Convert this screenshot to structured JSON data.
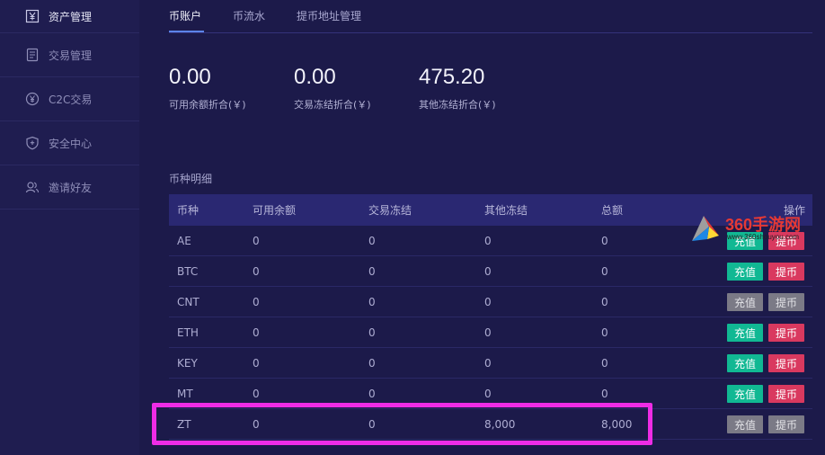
{
  "sidebar": {
    "items": [
      {
        "label": "资产管理",
        "icon": "yen-box-icon"
      },
      {
        "label": "交易管理",
        "icon": "document-icon"
      },
      {
        "label": "C2C交易",
        "icon": "yen-circle-icon"
      },
      {
        "label": "安全中心",
        "icon": "shield-icon"
      },
      {
        "label": "邀请好友",
        "icon": "users-icon"
      }
    ]
  },
  "tabs": [
    "币账户",
    "币流水",
    "提币地址管理"
  ],
  "stats": [
    {
      "value": "0.00",
      "label": "可用余额折合(￥)"
    },
    {
      "value": "0.00",
      "label": "交易冻结折合(￥)"
    },
    {
      "value": "475.20",
      "label": "其他冻结折合(￥)"
    }
  ],
  "section_title": "币种明细",
  "table": {
    "headers": [
      "币种",
      "可用余额",
      "交易冻结",
      "其他冻结",
      "总额",
      "操作"
    ],
    "rows": [
      {
        "coin": "AE",
        "available": "0",
        "trade_frozen": "0",
        "other_frozen": "0",
        "total": "0",
        "enabled": true
      },
      {
        "coin": "BTC",
        "available": "0",
        "trade_frozen": "0",
        "other_frozen": "0",
        "total": "0",
        "enabled": true
      },
      {
        "coin": "CNT",
        "available": "0",
        "trade_frozen": "0",
        "other_frozen": "0",
        "total": "0",
        "enabled": false
      },
      {
        "coin": "ETH",
        "available": "0",
        "trade_frozen": "0",
        "other_frozen": "0",
        "total": "0",
        "enabled": true
      },
      {
        "coin": "KEY",
        "available": "0",
        "trade_frozen": "0",
        "other_frozen": "0",
        "total": "0",
        "enabled": true
      },
      {
        "coin": "MT",
        "available": "0",
        "trade_frozen": "0",
        "other_frozen": "0",
        "total": "0",
        "enabled": true
      },
      {
        "coin": "ZT",
        "available": "0",
        "trade_frozen": "0",
        "other_frozen": "8,000",
        "total": "8,000",
        "enabled": false
      }
    ],
    "deposit_label": "充值",
    "withdraw_label": "提币"
  },
  "watermark": {
    "text": "360手游网",
    "url": "www.360shouyou.com"
  },
  "colors": {
    "background": "#1c1a4a",
    "sidebar": "#1f1d50",
    "table_header": "#2a2872",
    "deposit": "#11b893",
    "withdraw": "#d9395f",
    "disabled": "#7b7a86",
    "highlight": "#ee2ce6",
    "tab_underline": "#5c84e8"
  }
}
